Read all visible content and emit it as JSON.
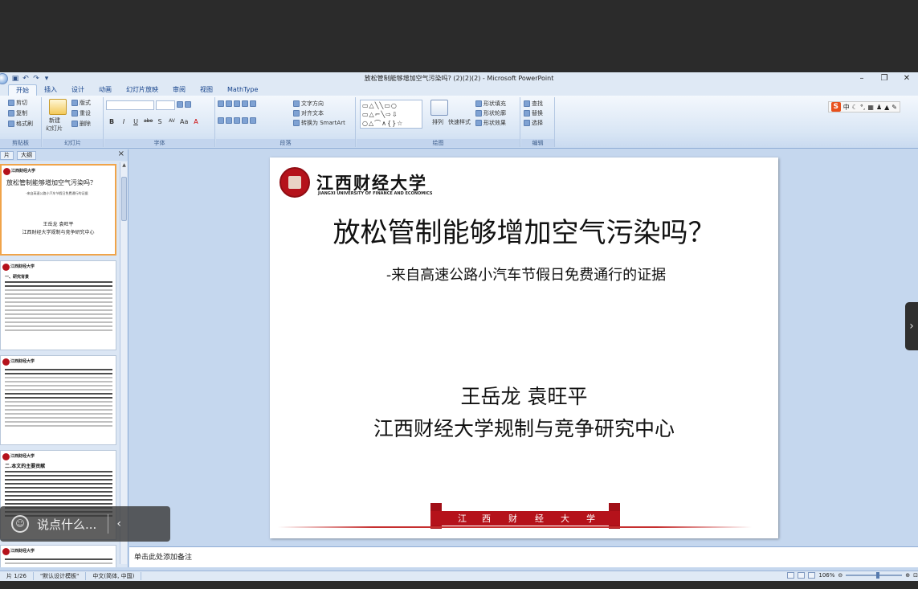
{
  "window": {
    "title": "放松管制能够增加空气污染吗? (2)(2)(2) - Microsoft PowerPoint",
    "minimize": "–",
    "restore": "❐",
    "close": "✕"
  },
  "tabs": [
    "开始",
    "插入",
    "设计",
    "动画",
    "幻灯片放映",
    "审阅",
    "视图",
    "MathType"
  ],
  "ribbon": {
    "clipboard": {
      "label": "剪贴板",
      "cut": "剪切",
      "copy": "复制",
      "paste_format": "格式刷"
    },
    "slides": {
      "label": "幻灯片",
      "new_slide": "新建",
      "new_slide2": "幻灯片",
      "layout": "版式",
      "reset": "重设",
      "delete": "删除"
    },
    "font": {
      "label": "字体",
      "buttons": [
        "B",
        "I",
        "U",
        "abe",
        "S",
        "AV",
        "Aa",
        "A"
      ]
    },
    "paragraph": {
      "label": "段落",
      "text_direction": "文字方向",
      "align_text": "对齐文本",
      "smartart": "转换为 SmartArt"
    },
    "drawing": {
      "label": "绘图",
      "arrange": "排列",
      "quick_styles": "快速样式",
      "fill": "形状填充",
      "outline": "形状轮廓",
      "effects": "形状效果"
    },
    "editing": {
      "label": "编辑",
      "find": "查找",
      "replace": "替换",
      "select": "选择"
    }
  },
  "ime": {
    "logo": "S",
    "mode": "中"
  },
  "left_panel": {
    "tab_slides": "片",
    "tab_outline": "大纲",
    "close": "×",
    "thumb1": {
      "logo": "江西财经大学",
      "title": "放松管制能够增加空气污染吗？",
      "sub": "-来自高速公路小汽车节假日免费通行的证据",
      "authors": "王岳龙 袁旺平",
      "inst": "江西财经大学规制与竞争研究中心"
    },
    "thumb2": {
      "logo": "江西财经大学",
      "head": "一、研究背景"
    },
    "thumb3": {
      "logo": "江西财经大学"
    },
    "thumb4": {
      "logo": "江西财经大学",
      "head": "二.本文的主要贡献"
    },
    "thumb5": {
      "logo": "江西财经大学"
    }
  },
  "overlay": {
    "icon": "☺",
    "text": "说点什么...",
    "chevron": "‹"
  },
  "slide": {
    "university": "江西财经大学",
    "university_en": "JIANGXI UNIVERSITY OF FINANCE AND ECONOMICS",
    "title": "放松管制能够增加空气污染吗？",
    "subtitle": "-来自高速公路小汽车节假日免费通行的证据",
    "authors": "王岳龙 袁旺平",
    "institution": "江西财经大学规制与竞争研究中心",
    "banner_chars": [
      "江",
      "西",
      "财",
      "经",
      "大",
      "学"
    ]
  },
  "nav_next": "›",
  "notes": {
    "placeholder": "单击此处添加备注"
  },
  "status": {
    "slide_count": "片 1/26",
    "theme": "\"默认设计模板\"",
    "language": "中文(简体, 中国)",
    "zoom": "106%"
  }
}
